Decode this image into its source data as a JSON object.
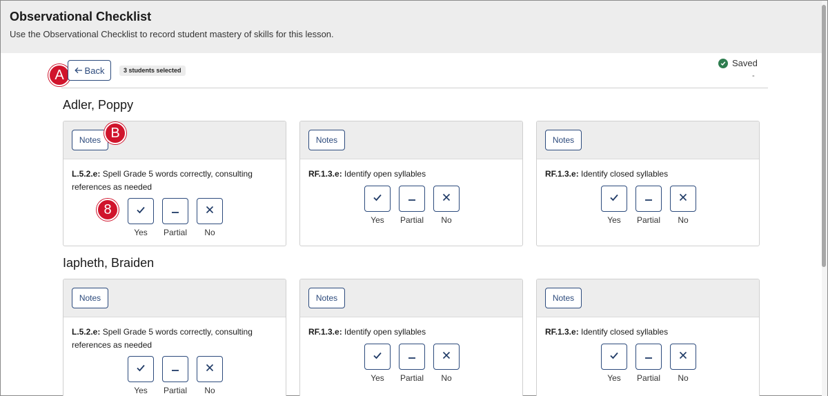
{
  "header": {
    "title": "Observational Checklist",
    "subtitle": "Use the Observational Checklist to record student mastery of skills for this lesson."
  },
  "toolbar": {
    "back_label": "Back",
    "selected_badge": "3 students selected",
    "saved_label": "Saved",
    "saved_sub": "-"
  },
  "markers": {
    "a": "A",
    "b": "B",
    "c": "8"
  },
  "options": {
    "yes": "Yes",
    "partial": "Partial",
    "no": "No"
  },
  "notes_label": "Notes",
  "students": [
    {
      "name": "Adler, Poppy",
      "cards": [
        {
          "code": "L.5.2.e:",
          "text": " Spell Grade 5 words correctly, consulting references as needed"
        },
        {
          "code": "RF.1.3.e:",
          "text": " Identify open syllables"
        },
        {
          "code": "RF.1.3.e:",
          "text": " Identify closed syllables"
        }
      ]
    },
    {
      "name": "Iapheth, Braiden",
      "cards": [
        {
          "code": "L.5.2.e:",
          "text": " Spell Grade 5 words correctly, consulting references as needed"
        },
        {
          "code": "RF.1.3.e:",
          "text": " Identify open syllables"
        },
        {
          "code": "RF.1.3.e:",
          "text": " Identify closed syllables"
        }
      ]
    }
  ],
  "colors": {
    "accent": "#2c4a7c",
    "marker": "#d0142c",
    "saved": "#2e7d4f",
    "header_bg": "#ededed"
  },
  "icons": {
    "back": "arrow-left-icon",
    "saved": "check-circle-icon",
    "yes": "check-icon",
    "partial": "minus-icon",
    "no": "x-icon"
  }
}
